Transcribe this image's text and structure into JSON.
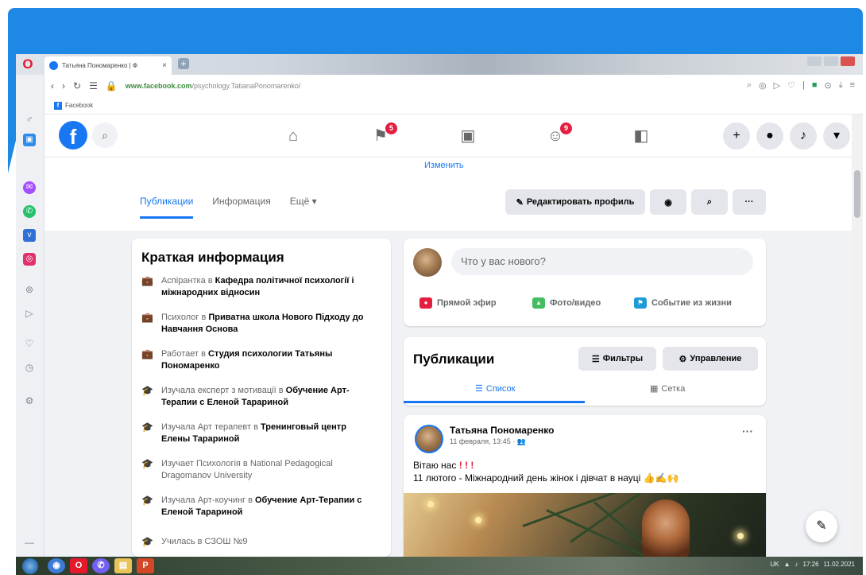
{
  "browser": {
    "tab_title": "Татьяна Пономаренко | Ф",
    "tab_close": "×",
    "new_tab": "+",
    "url_domain": "www.facebook.com",
    "url_path": "/psychology.TatianaPonomarenko/",
    "bookmark_label": "Facebook",
    "opera_logo": "O"
  },
  "fb": {
    "logo": "f",
    "notif_badge_1": "5",
    "notif_badge_2": "9"
  },
  "profile": {
    "change_link": "Изменить",
    "tabs": [
      "Публикации",
      "Информация",
      "Ещё ▾"
    ],
    "edit_profile": "Редактировать профиль"
  },
  "intro": {
    "title": "Краткая информация",
    "items": [
      {
        "pre": "Аспірантка в ",
        "bold": "Кафедра політичної психології і міжнародних відносин"
      },
      {
        "pre": "Психолог в ",
        "bold": "Приватна школа Нового Підходу до Навчання Основа"
      },
      {
        "pre": "Работает в ",
        "bold": "Студия психологии Татьяны Пономаренко"
      },
      {
        "pre": "Изучала експерт з мотивації в ",
        "bold": "Обучение Арт-Терапии с Еленой Тарариной"
      },
      {
        "pre": "Изучала Арт терапевт в ",
        "bold": "Тренинговый центр Елены Тарариной"
      },
      {
        "pre": "Изучает Психологія в ",
        "bold": "National Pedagogical Dragomanov University"
      },
      {
        "pre": "Изучала Арт-коучинг в ",
        "bold": "Обучение Арт-Терапии с Еленой Тарариной"
      },
      {
        "pre": "Училась в СЗОШ №9",
        "bold": ""
      }
    ]
  },
  "composer": {
    "placeholder": "Что у вас нового?",
    "live": "Прямой эфир",
    "photo": "Фото/видео",
    "event": "Событие из жизни"
  },
  "publications": {
    "title": "Публикации",
    "filters": "Фильтры",
    "manage": "Управление",
    "list_view": "Список",
    "grid_view": "Сетка"
  },
  "post": {
    "author": "Татьяна Пономаренко",
    "time": "11 февраля, 13:45 · ",
    "line1_text": "Вітаю нас",
    "line1_marks": "! ! !",
    "line2": "11 лютого - Міжнародний день жінок і дівчат в науці 👍✍🙌",
    "more": "···"
  },
  "taskbar": {
    "lang": "UK",
    "time": "17:26",
    "date": "11.02.2021"
  },
  "colors": {
    "brand_blue": "#1877f2",
    "slide_blue": "#1e88e5",
    "badge_red": "#e41e3f"
  }
}
